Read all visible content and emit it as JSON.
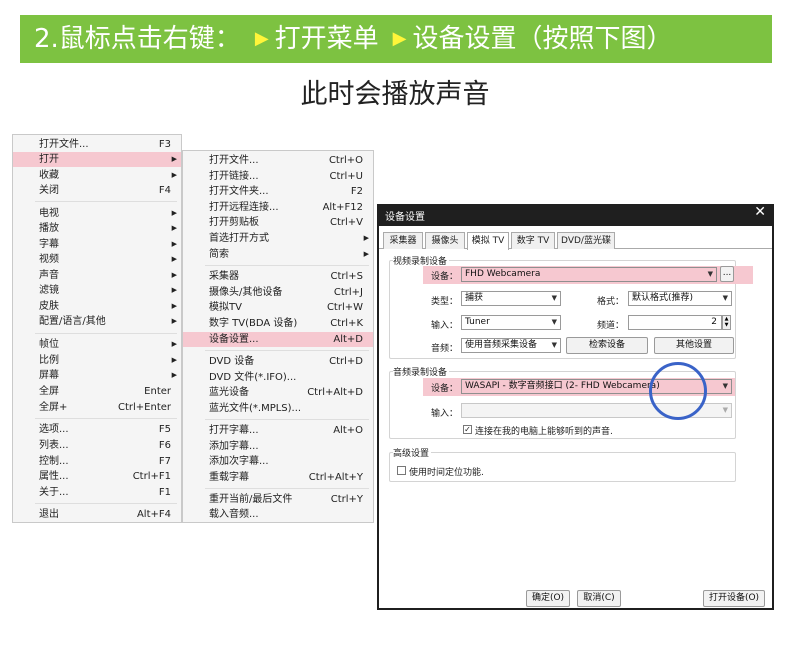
{
  "banner": {
    "step": "2.鼠标点击右键：",
    "item1": "打开菜单",
    "item2": "设备设置（按照下图）",
    "color": "#7dc241",
    "arrow_icon": "triangle-right-icon"
  },
  "subtitle": "此时会播放声音",
  "menu1": {
    "items": [
      {
        "label": "打开文件...",
        "shortcut": "F3"
      },
      {
        "label": "打开",
        "arrow": "▶"
      },
      {
        "label": "收藏",
        "arrow": "▶"
      },
      {
        "label": "关闭",
        "shortcut": "F4"
      },
      {
        "label": "电视",
        "arrow": "▶"
      },
      {
        "label": "播放",
        "arrow": "▶"
      },
      {
        "label": "字幕",
        "arrow": "▶"
      },
      {
        "label": "视频",
        "arrow": "▶"
      },
      {
        "label": "声音",
        "arrow": "▶"
      },
      {
        "label": "滤镜",
        "arrow": "▶"
      },
      {
        "label": "皮肤",
        "arrow": "▶"
      },
      {
        "label": "配置/语言/其他",
        "arrow": "▶"
      },
      {
        "label": "帧位",
        "arrow": "▶"
      },
      {
        "label": "比例",
        "arrow": "▶"
      },
      {
        "label": "屏幕",
        "arrow": "▶"
      },
      {
        "label": "全屏",
        "shortcut": "Enter"
      },
      {
        "label": "全屏+",
        "shortcut": "Ctrl+Enter"
      },
      {
        "label": "选项...",
        "shortcut": "F5"
      },
      {
        "label": "列表...",
        "shortcut": "F6"
      },
      {
        "label": "控制...",
        "shortcut": "F7"
      },
      {
        "label": "属性...",
        "shortcut": "Ctrl+F1"
      },
      {
        "label": "关于...",
        "shortcut": "F1"
      },
      {
        "label": "退出",
        "shortcut": "Alt+F4"
      }
    ]
  },
  "menu2": {
    "items": [
      {
        "label": "打开文件...",
        "shortcut": "Ctrl+O"
      },
      {
        "label": "打开链接...",
        "shortcut": "Ctrl+U"
      },
      {
        "label": "打开文件夹...",
        "shortcut": "F2"
      },
      {
        "label": "打开远程连接...",
        "shortcut": "Alt+F12"
      },
      {
        "label": "打开剪贴板",
        "shortcut": "Ctrl+V"
      },
      {
        "label": "首选打开方式",
        "arrow": "▶"
      },
      {
        "label": "简索",
        "arrow": "▶"
      },
      {
        "label": "采集器",
        "shortcut": "Ctrl+S"
      },
      {
        "label": "摄像头/其他设备",
        "shortcut": "Ctrl+J"
      },
      {
        "label": "模拟TV",
        "shortcut": "Ctrl+W"
      },
      {
        "label": "数字 TV(BDA 设备)",
        "shortcut": "Ctrl+K"
      },
      {
        "label": "设备设置...",
        "shortcut": "Alt+D"
      },
      {
        "label": "DVD 设备",
        "shortcut": "Ctrl+D"
      },
      {
        "label": "DVD 文件(*.IFO)...",
        "shortcut": ""
      },
      {
        "label": "蓝光设备",
        "shortcut": "Ctrl+Alt+D"
      },
      {
        "label": "蓝光文件(*.MPLS)...",
        "shortcut": ""
      },
      {
        "label": "打开字幕...",
        "shortcut": "Alt+O"
      },
      {
        "label": "添加字幕...",
        "shortcut": ""
      },
      {
        "label": "添加次字幕...",
        "shortcut": ""
      },
      {
        "label": "重载字幕",
        "shortcut": "Ctrl+Alt+Y"
      },
      {
        "label": "重开当前/最后文件",
        "shortcut": "Ctrl+Y"
      },
      {
        "label": "载入音频...",
        "shortcut": ""
      }
    ]
  },
  "dialog": {
    "title": "设备设置",
    "close": "✕",
    "tabs": [
      "采集器",
      "摄像头",
      "模拟 TV",
      "数字 TV",
      "DVD/蓝光碟"
    ],
    "active_tab": "模拟 TV",
    "video_group": {
      "label": "视频录制设备",
      "device_label": "设备：",
      "device_value": "FHD Webcamera",
      "browse": "...",
      "type_label": "类型：",
      "type_value": "捕获",
      "format_label": "格式：",
      "format_value": "默认格式(推荐)",
      "input_label": "输入：",
      "input_value": "Tuner",
      "channel_label": "频道：",
      "channel_value": "2",
      "audio_label": "音频：",
      "audio_value": "使用音频采集设备",
      "search_btn": "检索设备",
      "other_btn": "其他设置"
    },
    "audio_group": {
      "label": "音频录制设备",
      "device_label": "设备：",
      "device_value": "WASAPI - 数字音频接口 (2- FHD Webcamera)",
      "input_label": "输入：",
      "input_value": "",
      "listen_label": "连接在我的电脑上能够听到的声音.",
      "listen_checked": true
    },
    "advanced_group": {
      "label": "高级设置",
      "timestamp_label": "使用时间定位功能.",
      "timestamp_checked": false
    },
    "ok_btn": "确定(O)",
    "cancel_btn": "取消(C)",
    "open_device_btn": "打开设备(O)"
  },
  "highlight_color": "#f6c8d0",
  "circle_color": "#3a63c8"
}
